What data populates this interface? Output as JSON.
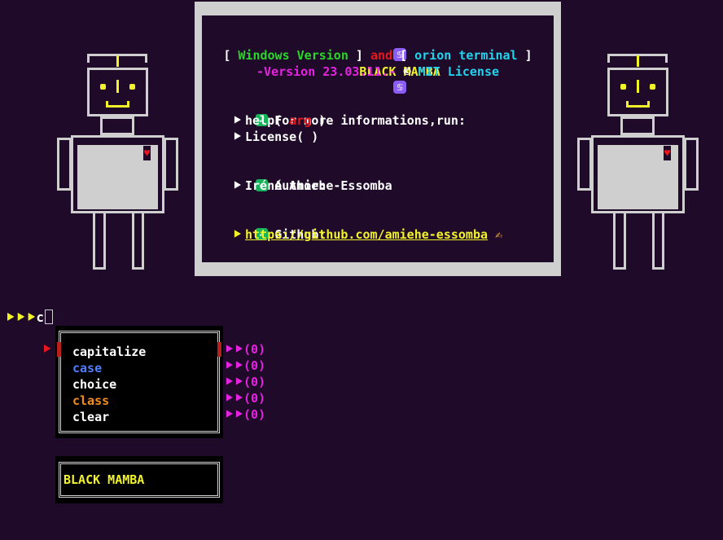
{
  "banner": {
    "title": "BLACK MAMBA",
    "logo_icon": "cancer-zodiac-icon",
    "line2": {
      "open1": "[ ",
      "windows": "Windows Version",
      "close1": " ] ",
      "and": "and",
      "open2": " [ ",
      "orion": "orion terminal",
      "close2": " ]"
    },
    "line3": {
      "version": "-Version 23.03.11.-",
      "copyright": " © ",
      "license": "MIT License"
    },
    "info_header": "For more informations,run:",
    "help_prefix": "help( ",
    "help_arg": "arg",
    "help_suffix": " )",
    "license_cmd": "License( )",
    "author_header": "Author:",
    "author_name": "Iréné Amiehe-Essomba",
    "github_header": "Github:",
    "github_url": "https://github.com/amiehe-essomba",
    "writing_icon": "✍"
  },
  "prompt": {
    "arrows": "⯈⯈⯈",
    "input": "c"
  },
  "completion": {
    "items": [
      {
        "label": "capitalize",
        "count": "(0)",
        "selected": true
      },
      {
        "label": "case",
        "count": "(0)"
      },
      {
        "label": "choice",
        "count": "(0)"
      },
      {
        "label": "class",
        "count": "(0)"
      },
      {
        "label": "clear",
        "count": "(0)"
      }
    ],
    "count_arrow": "⯈⯈"
  },
  "status": {
    "text": "BLACK MAMBA"
  },
  "colors": {
    "background": "#1f0a29",
    "yellow": "#f3f32a",
    "green": "#2ad62a",
    "red": "#e8161d",
    "cyan": "#22d3ee",
    "magenta": "#e522e0",
    "blue": "#4f7dff",
    "orange": "#f28c1a",
    "frame": "#cfcfcf"
  }
}
